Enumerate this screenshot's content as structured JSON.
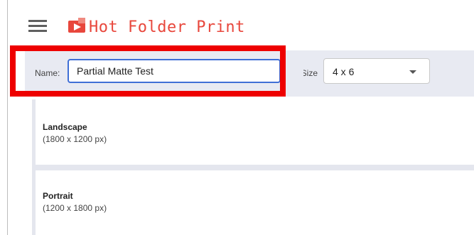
{
  "app": {
    "title": "Hot Folder Print",
    "brand_color": "#e8473c",
    "menu_icon": "hamburger-menu-icon",
    "logo_icon": "printer-logo-icon"
  },
  "toolbar": {
    "name_label": "Name:",
    "name_value": "Partial Matte Test",
    "size_label": "Size:",
    "size_value": "4 x 6",
    "size_dropdown_icon": "caret-down-icon",
    "input_focus_color": "#3f6fd6"
  },
  "highlight": {
    "color": "#ee0000"
  },
  "orientations": [
    {
      "title": "Landscape",
      "dims": "(1800 x 1200 px)"
    },
    {
      "title": "Portrait",
      "dims": "(1200 x 1800 px)"
    }
  ]
}
